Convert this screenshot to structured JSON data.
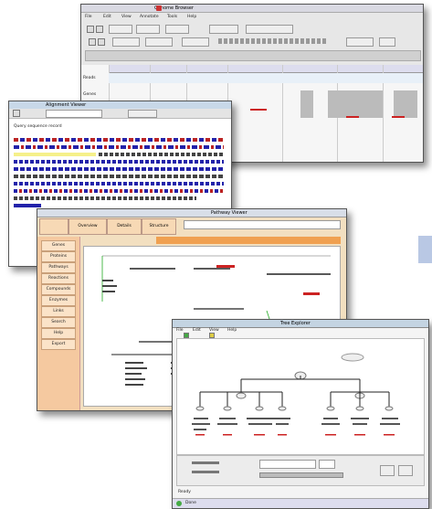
{
  "colors": {
    "accent_red": "#cc2222",
    "accent_blue": "#2233aa",
    "highlight_yellow": "#f5f08a",
    "orange_panel": "#f5c9a0",
    "side_blue": "#b9c8e4"
  },
  "win1": {
    "title": "Genome Browser",
    "menus": [
      "File",
      "Edit",
      "View",
      "Annotate",
      "Tools",
      "Help"
    ],
    "track_labels": [
      "Reads",
      "Genes",
      "Cov."
    ]
  },
  "win2": {
    "title": "Alignment Viewer",
    "heading": "Query sequence record"
  },
  "win3": {
    "title": "Pathway Viewer",
    "tabs": [
      "Overview",
      "Details",
      "Structure"
    ],
    "sidebar": [
      "Genes",
      "Proteins",
      "Pathways",
      "Reactions",
      "Compounds",
      "Enzymes",
      "Links",
      "Search",
      "Help",
      "Export"
    ]
  },
  "win4": {
    "title": "Tree Explorer",
    "menus": [
      "File",
      "Edit",
      "View",
      "Help"
    ],
    "status": "Ready",
    "footer": "Done"
  }
}
